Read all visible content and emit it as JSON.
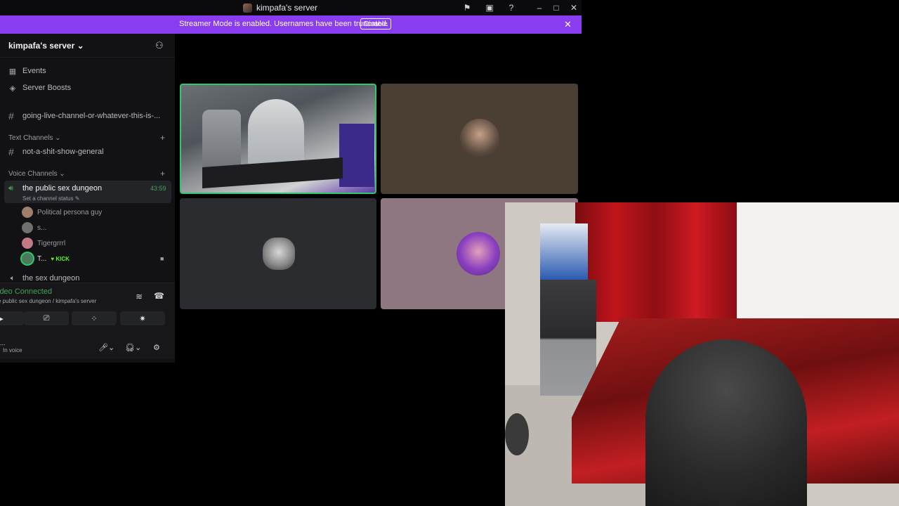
{
  "titlebar": {
    "title": "kimpafa's server"
  },
  "banner": {
    "message": "Streamer Mode is enabled. Usernames have been truncated.",
    "disable_label": "Disable"
  },
  "server": {
    "name": "kimpafa's server"
  },
  "nav": {
    "events": "Events",
    "boosts": "Server Boosts"
  },
  "channels": {
    "top": "going-live-channel-or-whatever-this-is-...",
    "text_category": "Text Channels",
    "text": [
      "not-a-shit-show-general"
    ],
    "voice_category": "Voice Channels",
    "active_voice": {
      "name": "the public sex dungeon",
      "status": "Set a channel status",
      "timer": "43:59"
    },
    "members": [
      {
        "name": "Political persona guy",
        "color": "#a07f6a"
      },
      {
        "name": "s...",
        "color": "#6f6f6f"
      },
      {
        "name": "Tigergrrrl",
        "color": "#c47a86"
      },
      {
        "name": "T...",
        "badge": "KICK",
        "color": "#4b7a5c"
      }
    ],
    "other_voice": "the sex dungeon"
  },
  "rtc": {
    "status": "ideo Connected",
    "path": "e public sex dungeon / kimpafa's server"
  },
  "user": {
    "name": "...",
    "status": "In voice"
  },
  "grid": {
    "tiles": [
      {
        "type": "video",
        "speaking": true
      },
      {
        "type": "avatar",
        "color": "#4b3e33"
      },
      {
        "type": "avatar",
        "color": "#2b2c30"
      },
      {
        "type": "avatar",
        "color": "#8f7782"
      }
    ]
  },
  "colors": {
    "accent": "#8a3cf0",
    "green": "#43a25a",
    "kick": "#53fc18"
  }
}
